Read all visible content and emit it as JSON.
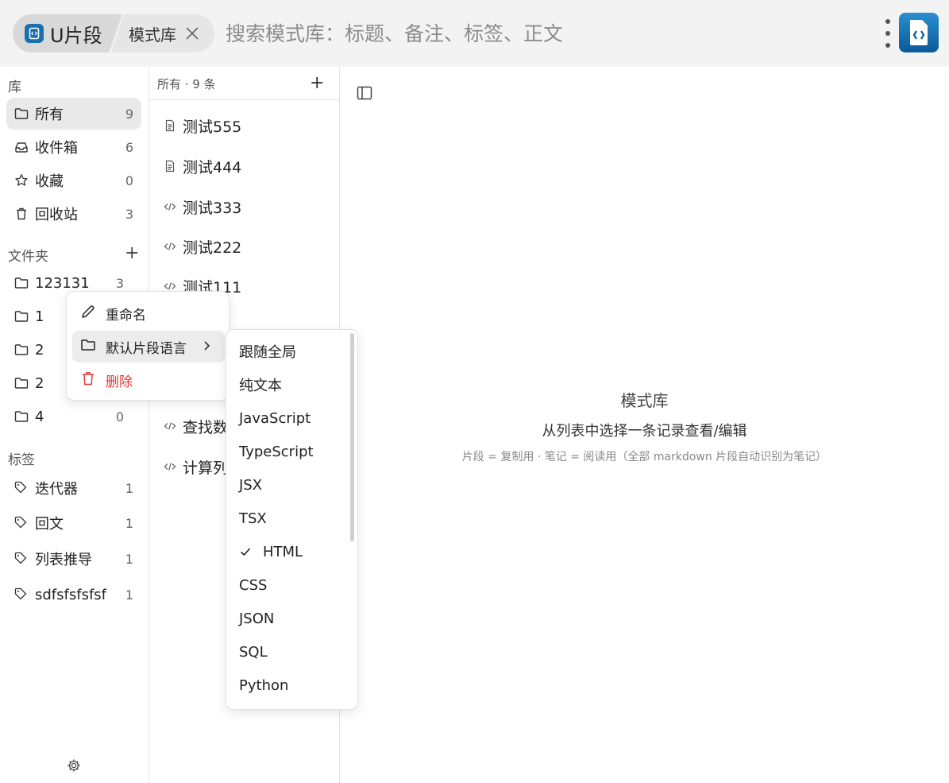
{
  "header": {
    "app_name": "U片段",
    "library_name": "模式库",
    "search_placeholder": "搜索模式库：标题、备注、标签、正文",
    "icons": [
      "app-logo-icon",
      "close-icon",
      "more-vertical-icon",
      "app-badge-icon"
    ]
  },
  "sidebar": {
    "library_title": "库",
    "library_items": [
      {
        "label": "所有",
        "count": "9",
        "icon": "folder-icon"
      },
      {
        "label": "收件箱",
        "count": "6",
        "icon": "inbox-icon"
      },
      {
        "label": "收藏",
        "count": "0",
        "icon": "star-icon"
      },
      {
        "label": "回收站",
        "count": "3",
        "icon": "trash-icon"
      }
    ],
    "folders_title": "文件夹",
    "folders_add": "+",
    "folders": [
      {
        "label": "123131",
        "count": "3"
      },
      {
        "label": "1",
        "count": ""
      },
      {
        "label": "2",
        "count": ""
      },
      {
        "label": "2",
        "count": ""
      },
      {
        "label": "4",
        "count": "0"
      }
    ],
    "tags_title": "标签",
    "tags": [
      {
        "label": "迭代器",
        "count": "1"
      },
      {
        "label": "回文",
        "count": "1"
      },
      {
        "label": "列表推导",
        "count": "1"
      },
      {
        "label": "sdfsfsfsfsf",
        "count": "1"
      }
    ]
  },
  "list": {
    "header": "所有 · 9 条",
    "add": "+",
    "entries": [
      {
        "label": "测试555",
        "type": "note"
      },
      {
        "label": "测试444",
        "type": "note"
      },
      {
        "label": "测试333",
        "type": "code"
      },
      {
        "label": "测试222",
        "type": "code"
      },
      {
        "label": "测试111",
        "type": "code"
      },
      {
        "label": "查找数",
        "type": "code"
      },
      {
        "label": "计算列",
        "type": "code"
      }
    ]
  },
  "main": {
    "title": "模式库",
    "subtitle": "从列表中选择一条记录查看/编辑",
    "hint": "片段 = 复制用 · 笔记 = 阅读用（全部 markdown 片段自动识别为笔记）"
  },
  "context_menu": {
    "rename": "重命名",
    "default_language": "默认片段语言",
    "delete": "删除"
  },
  "language_submenu": {
    "selected": "HTML",
    "options": [
      "跟随全局",
      "纯文本",
      "JavaScript",
      "TypeScript",
      "JSX",
      "TSX",
      "HTML",
      "CSS",
      "JSON",
      "SQL",
      "Python"
    ]
  },
  "colors": {
    "accent": "#1b6fb0",
    "danger": "#e03a3a",
    "topbar_bg": "#f3f3f3",
    "active_bg": "#e9e9e9"
  }
}
